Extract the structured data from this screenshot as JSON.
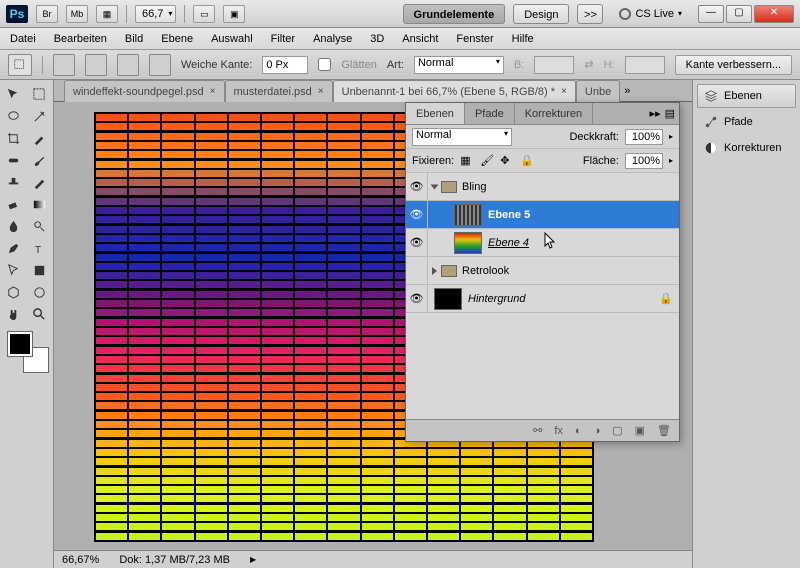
{
  "titlebar": {
    "logo": "Ps",
    "buttons": [
      "Br",
      "Mb"
    ],
    "zoom": "66,7",
    "workspace_tabs": [
      "Grundelemente",
      "Design"
    ],
    "more": ">>",
    "cslive": "CS Live"
  },
  "menu": [
    "Datei",
    "Bearbeiten",
    "Bild",
    "Ebene",
    "Auswahl",
    "Filter",
    "Analyse",
    "3D",
    "Ansicht",
    "Fenster",
    "Hilfe"
  ],
  "options": {
    "weiche_kante_label": "Weiche Kante:",
    "weiche_kante_value": "0 Px",
    "glaetten_label": "Glätten",
    "art_label": "Art:",
    "art_value": "Normal",
    "b_label": "B:",
    "h_label": "H:",
    "improve_btn": "Kante verbessern..."
  },
  "doc_tabs": [
    {
      "label": "windeffekt-soundpegel.psd",
      "active": false
    },
    {
      "label": "musterdatei.psd",
      "active": false
    },
    {
      "label": "Unbenannt-1 bei 66,7% (Ebene 5, RGB/8) *",
      "active": true
    },
    {
      "label": "Unbe",
      "active": false
    }
  ],
  "status": {
    "zoom": "66,67%",
    "dok": "Dok: 1,37 MB/7,23 MB"
  },
  "layers_panel": {
    "tabs": [
      "Ebenen",
      "Pfade",
      "Korrekturen"
    ],
    "blend_mode": "Normal",
    "opacity_label": "Deckkraft:",
    "opacity_value": "100%",
    "lock_label": "Fixieren:",
    "fill_label": "Fläche:",
    "fill_value": "100%",
    "layers": [
      {
        "type": "group",
        "name": "Bling",
        "open": true,
        "indent": 0
      },
      {
        "type": "layer",
        "name": "Ebene 5",
        "selected": true,
        "indent": 1
      },
      {
        "type": "layer",
        "name": "Ebene 4",
        "selected": false,
        "indent": 1,
        "underline": true
      },
      {
        "type": "group",
        "name": "Retrolook",
        "open": false,
        "indent": 0
      },
      {
        "type": "layer",
        "name": "Hintergrund",
        "selected": false,
        "indent": 0,
        "locked": true
      }
    ]
  },
  "dock": [
    {
      "label": "Ebenen",
      "active": true
    },
    {
      "label": "Pfade",
      "active": false
    },
    {
      "label": "Korrekturen",
      "active": false
    }
  ]
}
